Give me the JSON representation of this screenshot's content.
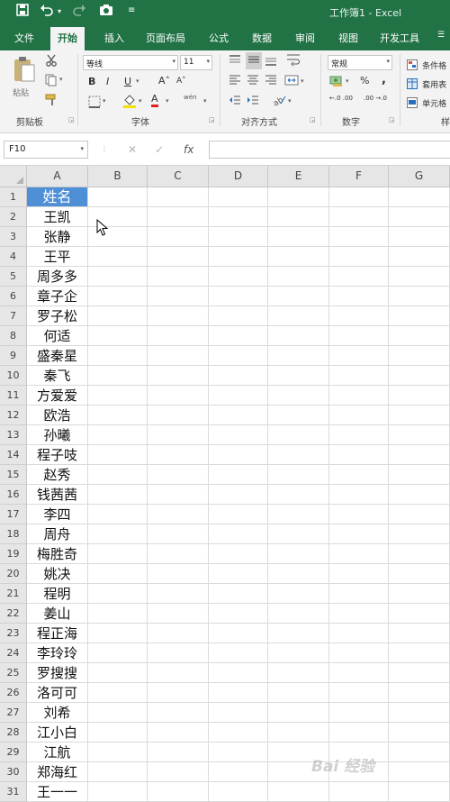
{
  "window": {
    "title": "工作簿1 - Excel"
  },
  "quick_access": {
    "save_icon": "save-icon",
    "undo_icon": "undo-icon",
    "redo_icon": "redo-icon",
    "camera_icon": "camera-icon",
    "customize_icon": "customize-icon"
  },
  "tabs": [
    "文件",
    "开始",
    "插入",
    "页面布局",
    "公式",
    "数据",
    "审阅",
    "视图",
    "开发工具"
  ],
  "active_tab": "开始",
  "ribbon": {
    "clipboard": {
      "paste_label": "粘贴",
      "group_label": "剪贴板"
    },
    "font": {
      "font_name": "等线",
      "font_size": "11",
      "bold": "B",
      "italic": "I",
      "underline": "U",
      "grow": "A˄",
      "shrink": "A˅",
      "font_color": "A",
      "phonetic": "wén",
      "group_label": "字体"
    },
    "alignment": {
      "group_label": "对齐方式"
    },
    "number": {
      "format": "常规",
      "percent": "%",
      "comma": ",",
      "increase_decimal": "←.0 .00",
      "decrease_decimal": ".00 →.0",
      "group_label": "数字"
    },
    "styles": {
      "conditional": "条件格",
      "table_format": "套用表",
      "cell_style": "单元格",
      "group_label": "样"
    }
  },
  "formula_bar": {
    "name_box": "F10",
    "cancel": "✕",
    "enter": "✓",
    "fx": "fx",
    "value": ""
  },
  "columns": [
    "A",
    "B",
    "C",
    "D",
    "E",
    "F",
    "G"
  ],
  "rows": [
    "1",
    "2",
    "3",
    "4",
    "5",
    "6",
    "7",
    "8",
    "9",
    "10",
    "11",
    "12",
    "13",
    "14",
    "15",
    "16",
    "17",
    "18",
    "19",
    "20",
    "21",
    "22",
    "23",
    "24",
    "25",
    "26",
    "27",
    "28",
    "29",
    "30",
    "31"
  ],
  "column_a_values": [
    "姓名",
    "王凯",
    "张静",
    "王平",
    "周多多",
    "章子企",
    "罗子松",
    "何适",
    "盛秦星",
    "秦飞",
    "方爱爱",
    "欧浩",
    "孙曦",
    "程子吱",
    "赵秀",
    "钱茜茜",
    "李四",
    "周舟",
    "梅胜奇",
    "姚决",
    "程明",
    "姜山",
    "程正海",
    "李玲玲",
    "罗搜搜",
    "洛可可",
    "刘希",
    "江小白",
    "江航",
    "郑海红",
    "王一一"
  ],
  "watermark": "Bai 经验",
  "colors": {
    "excel_green": "#217346",
    "header_fill": "#4e8fd6",
    "ribbon_bg": "#f3f3f3"
  }
}
